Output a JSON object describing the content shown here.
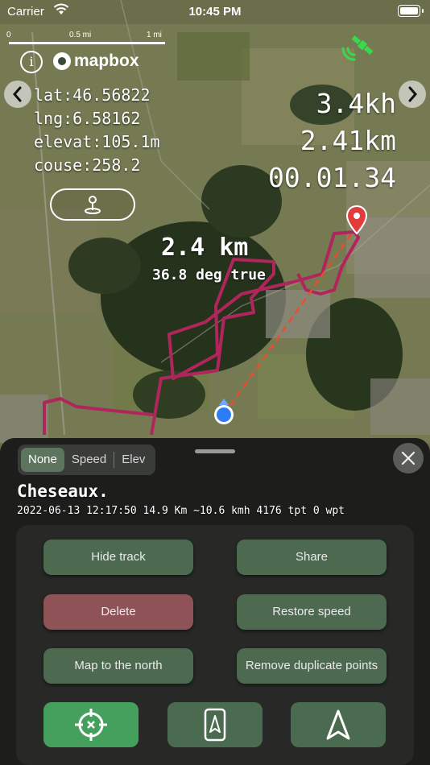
{
  "status_bar": {
    "carrier": "Carrier",
    "time": "10:45 PM"
  },
  "scale_bar": {
    "labels": [
      "0",
      "0.5 mi",
      "1 mi"
    ]
  },
  "map": {
    "attribution": "mapbox",
    "coords": {
      "lat": "lat:46.56822",
      "lng": "lng:6.58162",
      "elevation": "elevat:105.1m",
      "course": "couse:258.2"
    },
    "stats": {
      "speed": "3.4kh",
      "distance": "2.41km",
      "elapsed": "00.01.34"
    },
    "measure": {
      "distance": "2.4 km",
      "bearing": "36.8 deg true"
    },
    "colors": {
      "track": "#b0265c",
      "gps_icon": "#3ad84a",
      "location_dot": "#2d7cf6",
      "target_pin": "#e23b3b"
    }
  },
  "sheet": {
    "segments": [
      "None",
      "Speed",
      "Elev"
    ],
    "selected_segment": "None",
    "track_title": "Cheseaux.",
    "track_meta": "2022-06-13 12:17:50 14.9 Km ~10.6 kmh 4176 tpt 0 wpt",
    "buttons": {
      "hide_track": "Hide track",
      "share": "Share",
      "delete": "Delete",
      "restore_speed": "Restore speed",
      "map_north": "Map to the north",
      "remove_duplicates": "Remove duplicate points"
    },
    "icons": [
      "crosshair-icon",
      "phone-navigation-icon",
      "navigation-arrow-icon"
    ]
  }
}
